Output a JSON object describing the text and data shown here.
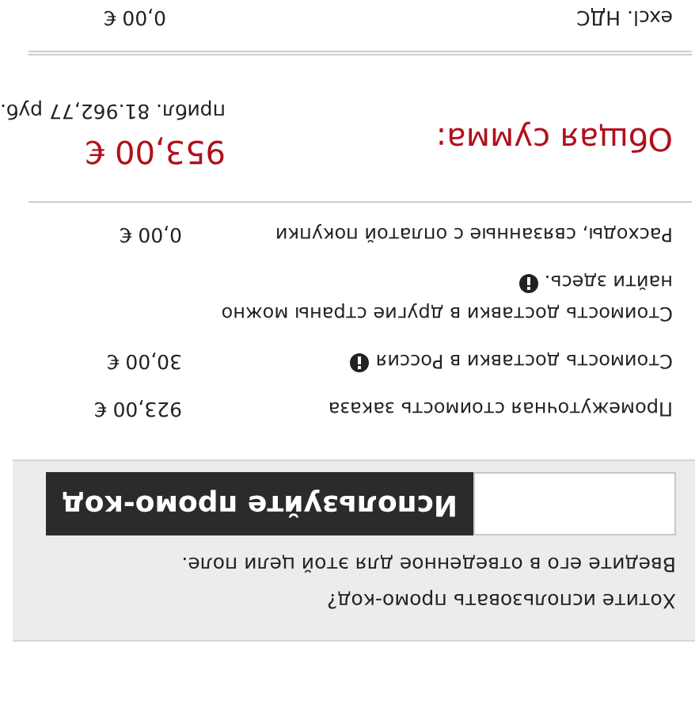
{
  "promo": {
    "question": "Хотите использовать промо-код?",
    "hint": "Введите его в отведенное для этой цели поле.",
    "button": "Используйте промо-код"
  },
  "rows": [
    {
      "label": "Промежуточная стоимость заказа",
      "value": "923,00 €",
      "info": false
    },
    {
      "label": "Стоимость доставки в Россия",
      "value": "30,00 €",
      "info": true
    },
    {
      "label": "Стоимость доставки в другие страны можно найти здесь.",
      "info": true
    },
    {
      "label": "Расходы, связанные с оплатой покупки",
      "value": "0,00 €",
      "info": false
    }
  ],
  "total": {
    "label": "Общая сумма:",
    "value": "953,00 €",
    "approx": "прибл. 81.962,77 руб."
  },
  "tax": {
    "label": "excl. НДС",
    "value": "0,00 €"
  }
}
